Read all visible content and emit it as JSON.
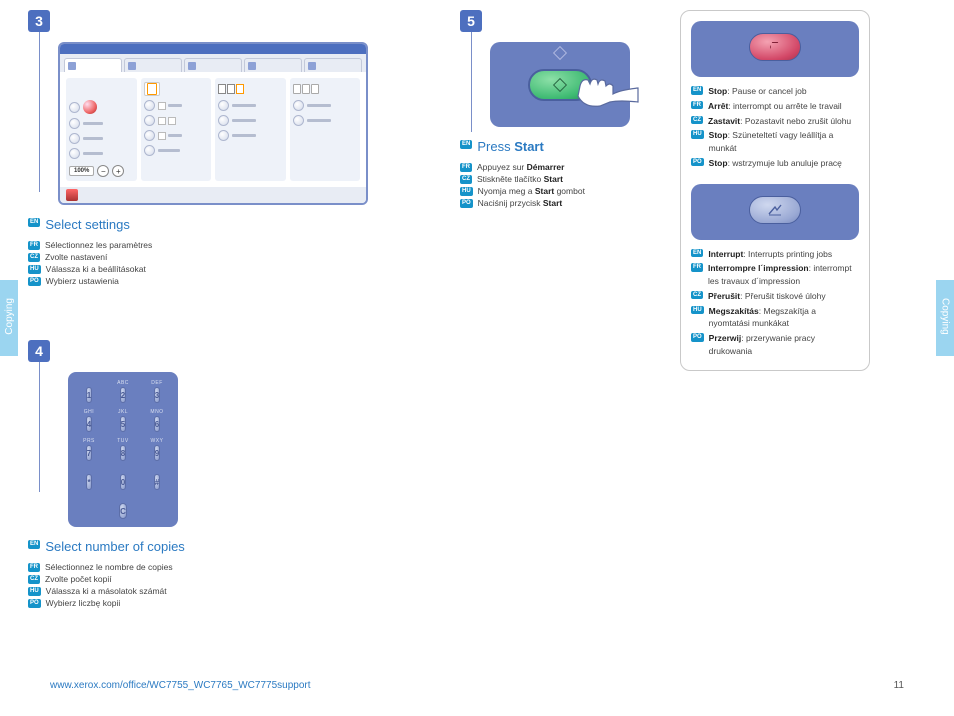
{
  "side_tab_label": "Copying",
  "footer_url": "www.xerox.com/office/WC7755_WC7765_WC7775support",
  "page_number": "11",
  "step3": {
    "num": "3",
    "heading": "Select settings",
    "translations": [
      {
        "tag": "FR",
        "text": "Sélectionnez les paramètres"
      },
      {
        "tag": "CZ",
        "text": "Zvolte nastavení"
      },
      {
        "tag": "HU",
        "text": "Válassza ki a beállításokat"
      },
      {
        "tag": "PO",
        "text": "Wybierz ustawienia"
      }
    ],
    "zoom_pct": "100%"
  },
  "step4": {
    "num": "4",
    "heading": "Select number of copies",
    "translations": [
      {
        "tag": "FR",
        "text": "Sélectionnez le nombre de copies"
      },
      {
        "tag": "CZ",
        "text": "Zvolte počet kopií"
      },
      {
        "tag": "HU",
        "text": "Válassza ki a másolatok számát"
      },
      {
        "tag": "PO",
        "text": "Wybierz liczbę kopii"
      }
    ],
    "keys_top": [
      "",
      "ABC",
      "DEF",
      "GHI",
      "JKL",
      "MNO",
      "PRS",
      "TUV",
      "WXY",
      "",
      "",
      ""
    ],
    "keys": [
      "1",
      "2",
      "3",
      "4",
      "5",
      "6",
      "7",
      "8",
      "9",
      "*",
      "0",
      "#",
      "",
      "C",
      ""
    ]
  },
  "step5": {
    "num": "5",
    "heading_pre": "Press ",
    "heading_bold": "Start",
    "translations": [
      {
        "tag": "FR",
        "pre": "Appuyez sur ",
        "bold": "Démarrer"
      },
      {
        "tag": "CZ",
        "pre": "Stiskněte tlačítko ",
        "bold": "Start"
      },
      {
        "tag": "HU",
        "pre": "Nyomja meg a ",
        "bold": "Start",
        "post": " gombot"
      },
      {
        "tag": "PO",
        "pre": "Naciśnij przycisk ",
        "bold": "Start"
      }
    ]
  },
  "card": {
    "stop": {
      "en_bold": "Stop",
      "en_rest": ": Pause or cancel job",
      "translations": [
        {
          "tag": "FR",
          "bold": "Arrêt",
          "rest": ": interrompt ou arrête le travail"
        },
        {
          "tag": "CZ",
          "bold": "Zastavit",
          "rest": ": Pozastavit nebo zrušit úlohu"
        },
        {
          "tag": "HU",
          "bold": "Stop",
          "rest": ": Szüneteltetí vagy leállítja a munkát"
        },
        {
          "tag": "PO",
          "bold": "Stop",
          "rest": ": wstrzymuje lub anuluje pracę"
        }
      ]
    },
    "interrupt": {
      "en_bold": "Interrupt",
      "en_rest": ": Interrupts printing jobs",
      "translations": [
        {
          "tag": "FR",
          "bold": "Interrompre l´impression",
          "rest": ": interrompt les travaux d´impression"
        },
        {
          "tag": "CZ",
          "bold": "Přerušit",
          "rest": ": Přerušit tiskové úlohy"
        },
        {
          "tag": "HU",
          "bold": "Megszakítás",
          "rest": ": Megszakítja a nyomtatási munkákat"
        },
        {
          "tag": "PO",
          "bold": "Przerwij",
          "rest": ": przerywanie pracy drukowania"
        }
      ]
    }
  }
}
